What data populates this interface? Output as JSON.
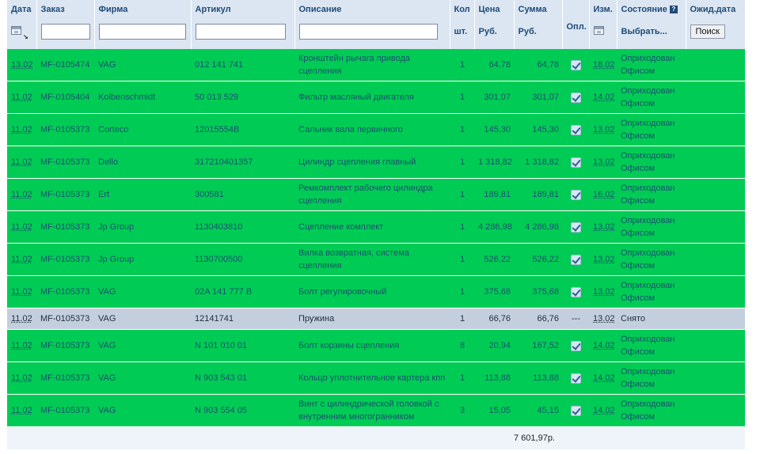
{
  "headers": {
    "date": "Дата",
    "order": "Заказ",
    "firm": "Фирма",
    "article": "Артикул",
    "description": "Описание",
    "qty": "Кол",
    "qty_unit": "шт.",
    "price": "Цена",
    "price_unit": "Руб.",
    "sum": "Сумма",
    "sum_unit": "Руб.",
    "paid": "Опл.",
    "changed": "Изм.",
    "state": "Состояние",
    "state_select": "Выбрать...",
    "expected": "Ожид.дата",
    "search_button": "Поиск"
  },
  "filters": {
    "order": "",
    "firm": "",
    "article": "",
    "description": ""
  },
  "rows": [
    {
      "date": "13.02",
      "order": "MF-0105474",
      "firm": "VAG",
      "article": "012 141 741",
      "description": "Кронштейн рычага привода сцепления",
      "qty": "1",
      "price": "64,78",
      "sum": "64,78",
      "paid": true,
      "changed": "18.02",
      "state": "Оприходован Офисом",
      "status": "green"
    },
    {
      "date": "11.02",
      "order": "MF-0105404",
      "firm": "Kolbenschmidt",
      "article": "50 013 529",
      "description": "Фильтр масляный двигателя",
      "qty": "1",
      "price": "301,07",
      "sum": "301,07",
      "paid": true,
      "changed": "14.02",
      "state": "Оприходован Офисом",
      "status": "green"
    },
    {
      "date": "11.02",
      "order": "MF-0105373",
      "firm": "Corteco",
      "article": "12015554B",
      "description": "Сальник вала первичного",
      "qty": "1",
      "price": "145,30",
      "sum": "145,30",
      "paid": true,
      "changed": "13.02",
      "state": "Оприходован Офисом",
      "status": "green"
    },
    {
      "date": "11.02",
      "order": "MF-0105373",
      "firm": "Dello",
      "article": "317210401357",
      "description": "Цилиндр сцепления главный",
      "qty": "1",
      "price": "1 318,82",
      "sum": "1 318,82",
      "paid": true,
      "changed": "13.02",
      "state": "Оприходован Офисом",
      "status": "green"
    },
    {
      "date": "11.02",
      "order": "MF-0105373",
      "firm": "Ert",
      "article": "300581",
      "description": "Ремкомплект рабочего цилиндра сцепления",
      "qty": "1",
      "price": "189,81",
      "sum": "189,81",
      "paid": true,
      "changed": "16.02",
      "state": "Оприходован Офисом",
      "status": "green"
    },
    {
      "date": "11.02",
      "order": "MF-0105373",
      "firm": "Jp Group",
      "article": "1130403810",
      "description": "Сцепление комплект",
      "qty": "1",
      "price": "4 286,98",
      "sum": "4 286,98",
      "paid": true,
      "changed": "13.02",
      "state": "Оприходован Офисом",
      "status": "green"
    },
    {
      "date": "11.02",
      "order": "MF-0105373",
      "firm": "Jp Group",
      "article": "1130700500",
      "description": "Вилка возвратная, система сцепления",
      "qty": "1",
      "price": "526,22",
      "sum": "526,22",
      "paid": true,
      "changed": "13.02",
      "state": "Оприходован Офисом",
      "status": "green"
    },
    {
      "date": "11.02",
      "order": "MF-0105373",
      "firm": "VAG",
      "article": "02A 141 777 B",
      "description": "Болт регулировочный",
      "qty": "1",
      "price": "375,68",
      "sum": "375,68",
      "paid": true,
      "changed": "13.02",
      "state": "Оприходован Офисом",
      "status": "green"
    },
    {
      "date": "11.02",
      "order": "MF-0105373",
      "firm": "VAG",
      "article": "12141741",
      "description": "Пружина",
      "qty": "1",
      "price": "66,76",
      "sum": "66,76",
      "paid": false,
      "paid_text": "---",
      "changed": "13.02",
      "state": "Снято",
      "status": "grey"
    },
    {
      "date": "11.02",
      "order": "MF-0105373",
      "firm": "VAG",
      "article": "N 101 010 01",
      "description": "Болт корзины сцепления",
      "qty": "8",
      "price": "20,94",
      "sum": "167,52",
      "paid": true,
      "changed": "14.02",
      "state": "Оприходован Офисом",
      "status": "green"
    },
    {
      "date": "11.02",
      "order": "MF-0105373",
      "firm": "VAG",
      "article": "N 903 543 01",
      "description": "Кольцо уплотнительное картера кпп",
      "qty": "1",
      "price": "113,88",
      "sum": "113,88",
      "paid": true,
      "changed": "14.02",
      "state": "Оприходован Офисом",
      "status": "green"
    },
    {
      "date": "11.02",
      "order": "MF-0105373",
      "firm": "VAG",
      "article": "N 903 554 05",
      "description": "Винт с цилиндрической головкой с внутренним многогранником",
      "qty": "3",
      "price": "15,05",
      "sum": "45,15",
      "paid": true,
      "changed": "14.02",
      "state": "Оприходован Офисом",
      "status": "green"
    }
  ],
  "total": "7 601,97р.",
  "colors": {
    "row_green": "#00cc55",
    "row_grey": "#c3cfdc",
    "header_bg": "#dbe6f2",
    "header_text": "#1f4a78"
  }
}
